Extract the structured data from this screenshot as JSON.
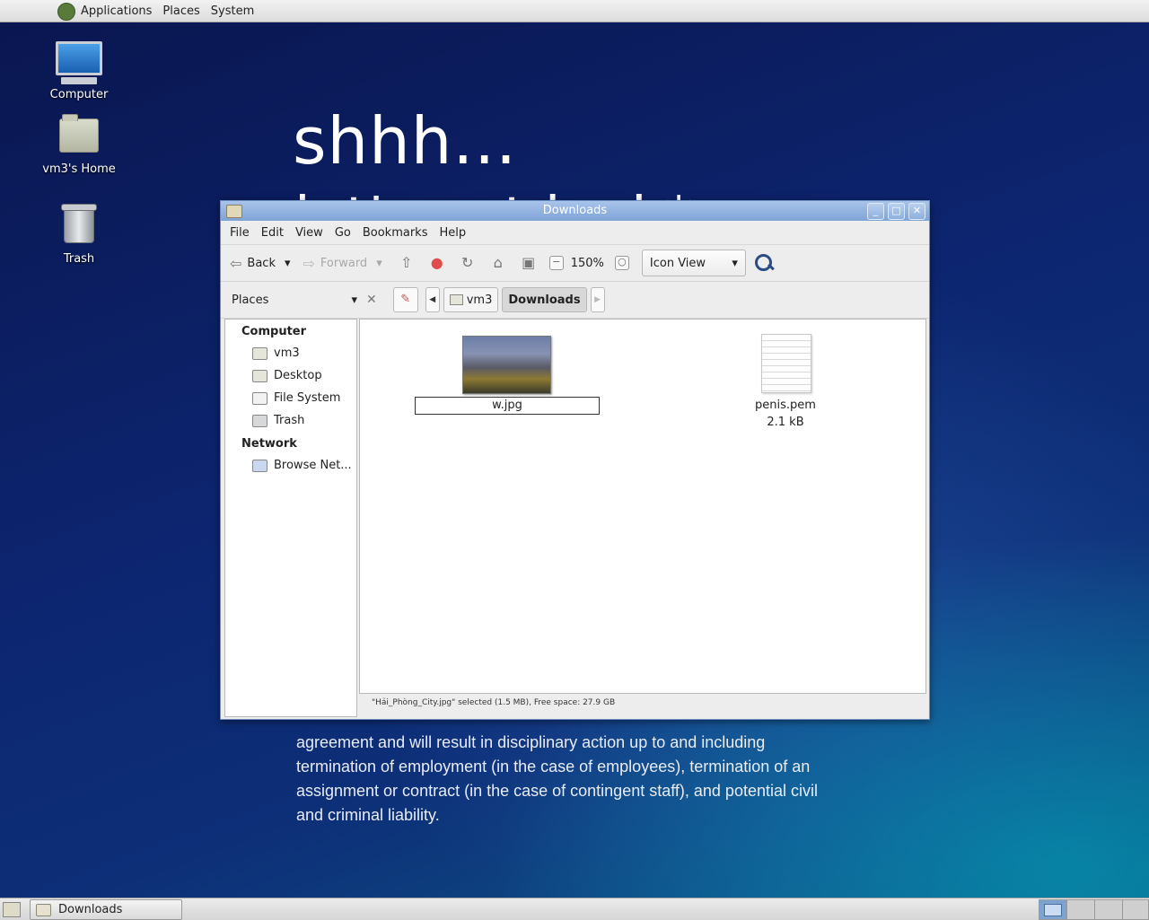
{
  "top_panel": {
    "menus": [
      "Applications",
      "Places",
      "System"
    ]
  },
  "desktop": {
    "icons": [
      {
        "label": "Computer"
      },
      {
        "label": "vm3's Home"
      },
      {
        "label": "Trash"
      }
    ],
    "wallpaper": {
      "headline": "shhh...",
      "subline": "let's not leak*",
      "body_lines": [
        "agreement and will result in disciplinary action up to and including",
        "termination of employment (in the case of employees), termination of an",
        "assignment or contract (in the case of contingent staff), and potential civil",
        "and criminal liability."
      ]
    }
  },
  "window": {
    "title": "Downloads",
    "controls": {
      "minimize": "_",
      "maximize": "□",
      "close": "✕"
    },
    "menubar": [
      "File",
      "Edit",
      "View",
      "Go",
      "Bookmarks",
      "Help"
    ],
    "toolbar": {
      "back": "Back",
      "forward": "Forward",
      "zoom": "150%",
      "view_mode": "Icon View"
    },
    "locationbar": {
      "side_pane": "Places",
      "crumbs": [
        "vm3",
        "Downloads"
      ]
    },
    "sidebar": {
      "computer_header": "Computer",
      "computer_items": [
        "vm3",
        "Desktop",
        "File System",
        "Trash"
      ],
      "network_header": "Network",
      "network_items": [
        "Browse Net..."
      ]
    },
    "files": [
      {
        "rename_value": "w.jpg",
        "type": "image"
      },
      {
        "name": "penis.pem",
        "size": "2.1 kB",
        "type": "document"
      }
    ],
    "status": "\"Hải_Phòng_City.jpg\" selected (1.5 MB), Free space: 27.9 GB"
  },
  "bottom_panel": {
    "task": "Downloads"
  },
  "colors": {
    "titlebar": "#7ea3d6",
    "wallpaper": "#0d2570"
  }
}
